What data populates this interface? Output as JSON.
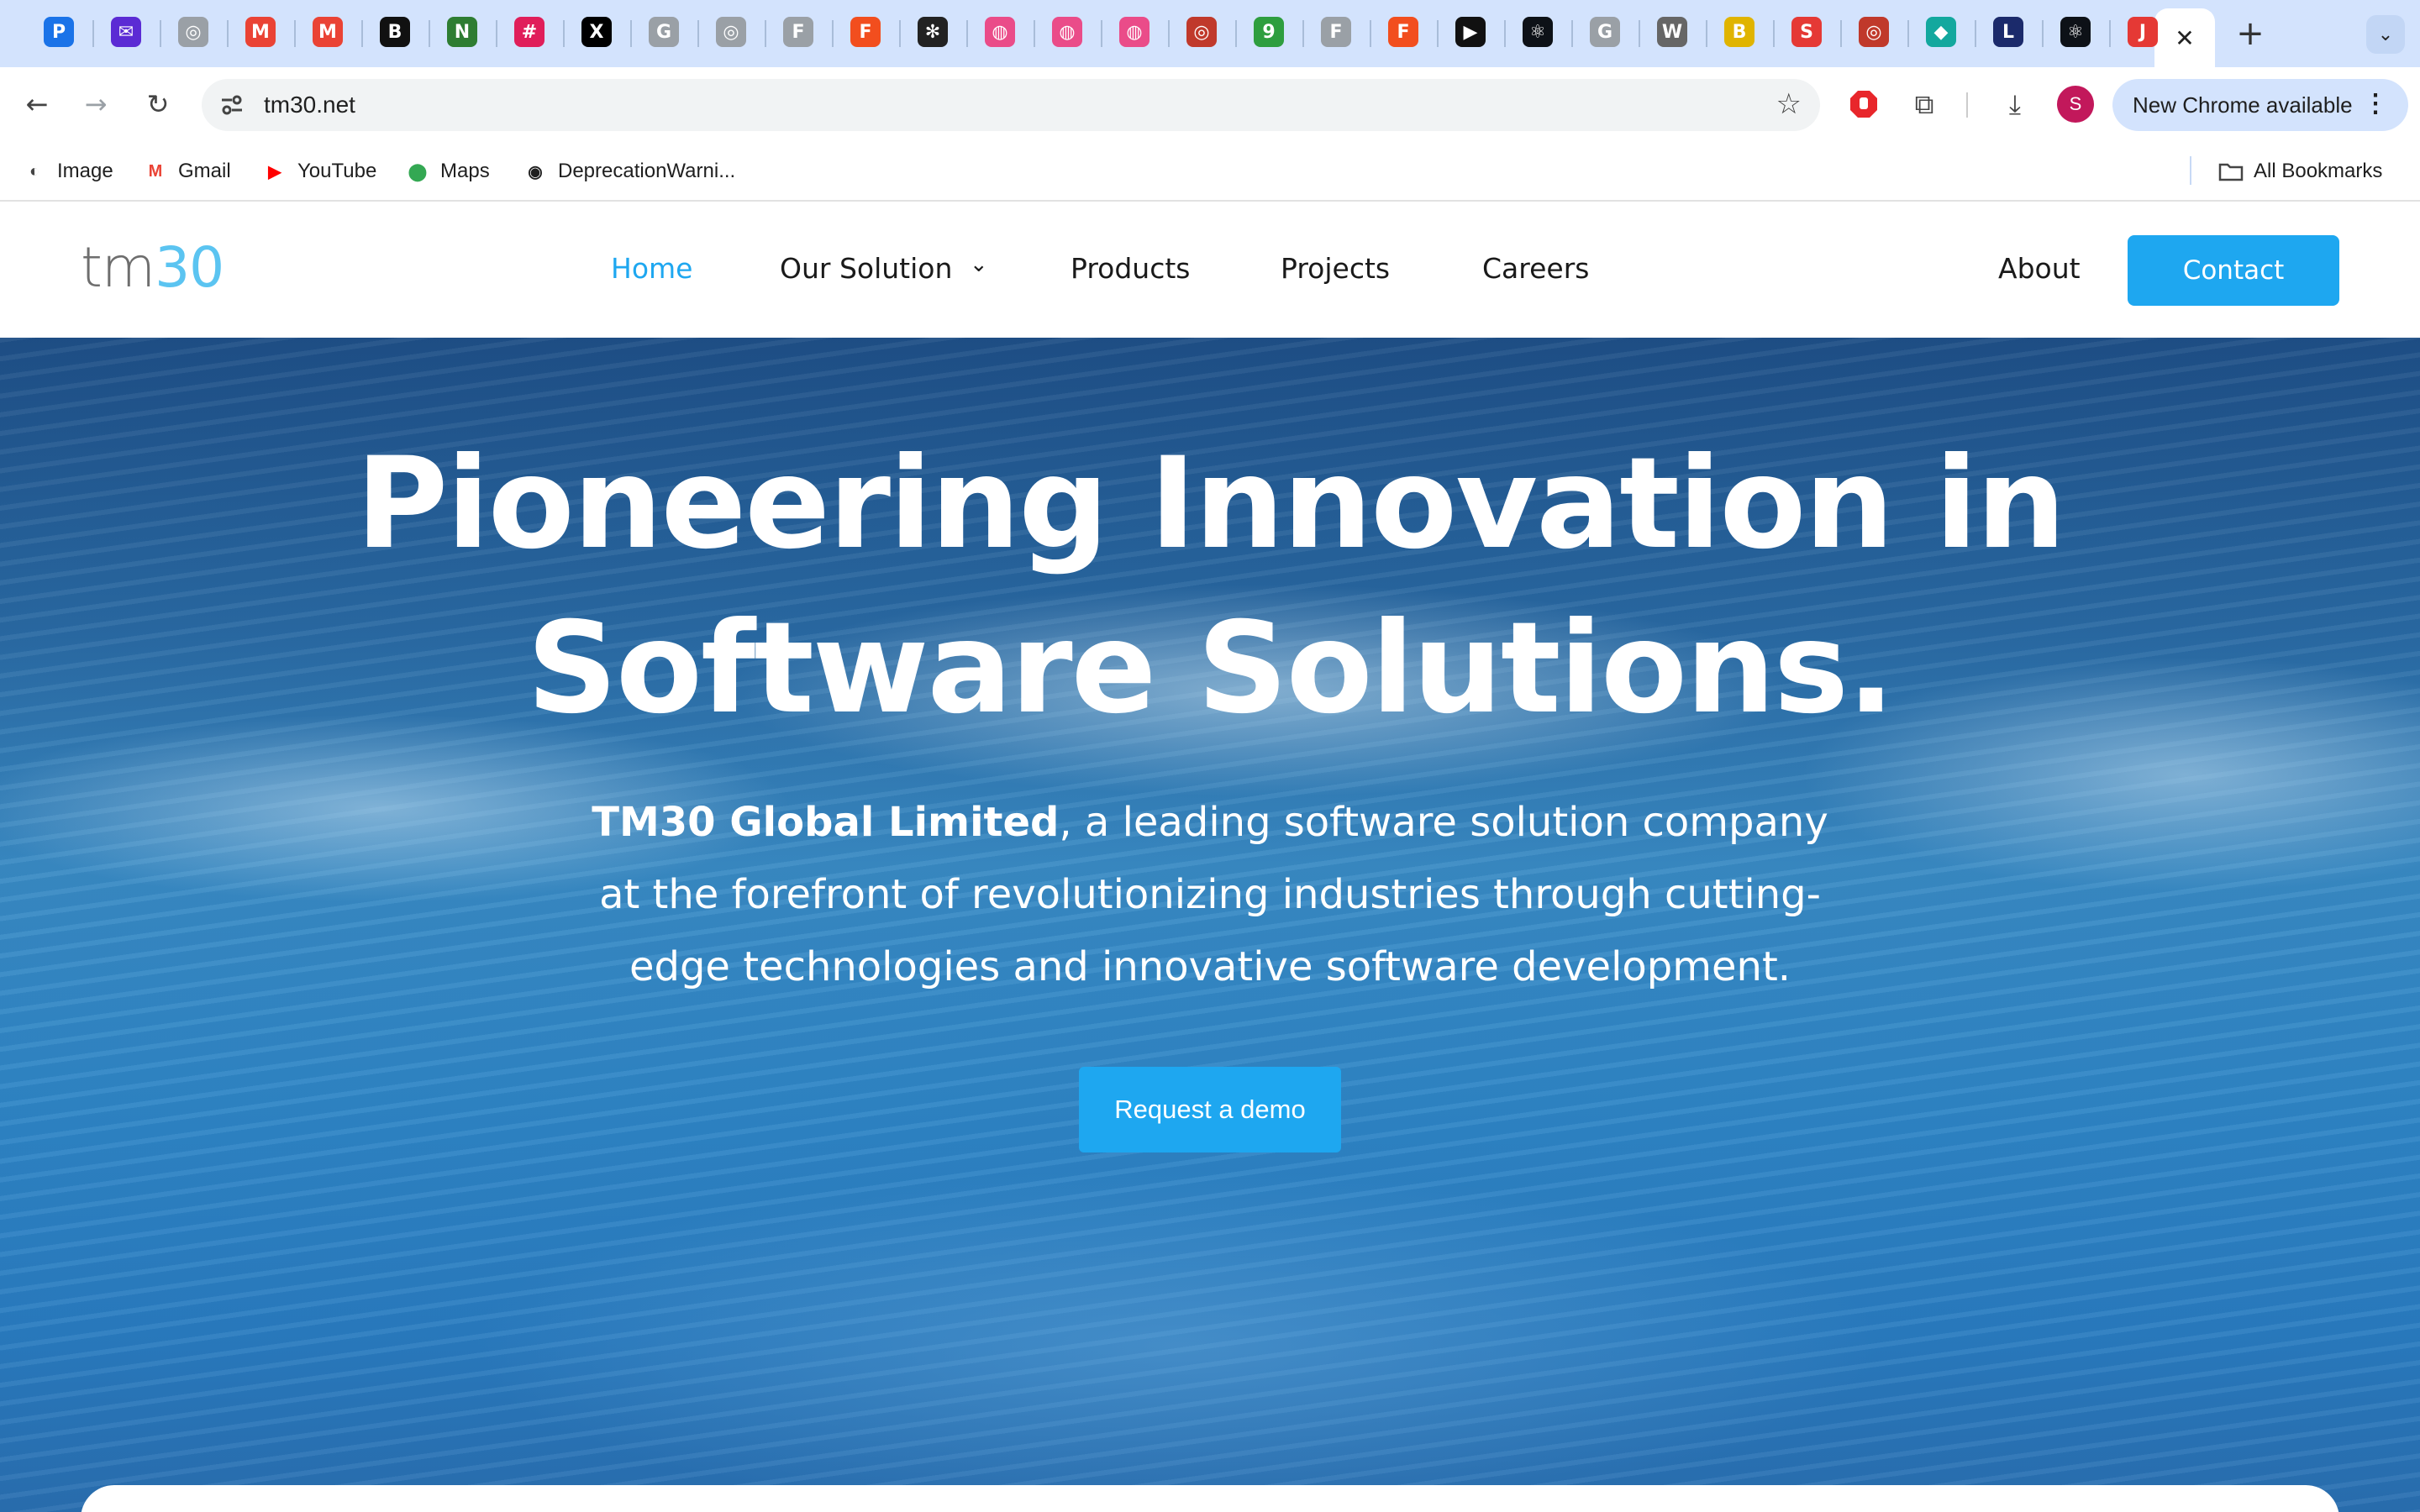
{
  "browser": {
    "tabs": [
      {
        "icon": "pipedrive-icon",
        "glyph": "P",
        "color": "#1a73e8"
      },
      {
        "icon": "mail-icon",
        "glyph": "✉",
        "color": "#5b2bd4"
      },
      {
        "icon": "chrome-page-icon",
        "glyph": "◎",
        "color": "#9aa0a6"
      },
      {
        "icon": "gmail-icon",
        "glyph": "M",
        "color": "#ea4335"
      },
      {
        "icon": "gmail-icon",
        "glyph": "M",
        "color": "#ea4335"
      },
      {
        "icon": "b-app-icon",
        "glyph": "B",
        "color": "#111111"
      },
      {
        "icon": "n-app-icon",
        "glyph": "N",
        "color": "#2e7d32"
      },
      {
        "icon": "slack-icon",
        "glyph": "#",
        "color": "#e01e5a"
      },
      {
        "icon": "x-icon",
        "glyph": "X",
        "color": "#000000"
      },
      {
        "icon": "google-icon",
        "glyph": "G",
        "color": "#9aa0a6"
      },
      {
        "icon": "web-icon",
        "glyph": "◎",
        "color": "#9aa0a6"
      },
      {
        "icon": "figma-page-icon",
        "glyph": "F",
        "color": "#9aa0a6"
      },
      {
        "icon": "figma-icon",
        "glyph": "F",
        "color": "#f24e1e"
      },
      {
        "icon": "openai-icon",
        "glyph": "✻",
        "color": "#222222"
      },
      {
        "icon": "dribbble-icon",
        "glyph": "◍",
        "color": "#ea4c89"
      },
      {
        "icon": "dribbble-icon",
        "glyph": "◍",
        "color": "#ea4c89"
      },
      {
        "icon": "dribbble-icon",
        "glyph": "◍",
        "color": "#ea4c89"
      },
      {
        "icon": "web-icon",
        "glyph": "◎",
        "color": "#c0392b"
      },
      {
        "icon": "naija-icon",
        "glyph": "9",
        "color": "#2e9e3f"
      },
      {
        "icon": "figma-page-icon",
        "glyph": "F",
        "color": "#9aa0a6"
      },
      {
        "icon": "figma-icon",
        "glyph": "F",
        "color": "#f24e1e"
      },
      {
        "icon": "play-icon",
        "glyph": "▶",
        "color": "#111111"
      },
      {
        "icon": "react-icon",
        "glyph": "⚛",
        "color": "#0d1117"
      },
      {
        "icon": "google-icon",
        "glyph": "G",
        "color": "#9aa0a6"
      },
      {
        "icon": "wikipedia-icon",
        "glyph": "W",
        "color": "#666666"
      },
      {
        "icon": "bank-icon",
        "glyph": "B",
        "color": "#e0b400"
      },
      {
        "icon": "s-app-icon",
        "glyph": "S",
        "color": "#e53935"
      },
      {
        "icon": "web-icon",
        "glyph": "◎",
        "color": "#c0392b"
      },
      {
        "icon": "diamond-icon",
        "glyph": "◆",
        "color": "#13a89e"
      },
      {
        "icon": "live-icon",
        "glyph": "L",
        "color": "#1b2a6b"
      },
      {
        "icon": "react-icon",
        "glyph": "⚛",
        "color": "#0d1117"
      },
      {
        "icon": "jpg-png-icon",
        "glyph": "J",
        "color": "#e53935"
      }
    ],
    "active_tab_close": "✕",
    "new_tab": "+",
    "tab_search": "⌄",
    "url": "tm30.net",
    "update_label": "New Chrome available",
    "update_menu": "⋮",
    "profile_initial": "S",
    "bookmarks": [
      {
        "label": "Image",
        "icon": "globe-icon",
        "glyph": "◐",
        "color": "#444444"
      },
      {
        "label": "Gmail",
        "icon": "gmail-icon",
        "glyph": "M",
        "color": "#ea4335"
      },
      {
        "label": "YouTube",
        "icon": "youtube-icon",
        "glyph": "▶",
        "color": "#ff0000"
      },
      {
        "label": "Maps",
        "icon": "maps-icon",
        "glyph": "⬤",
        "color": "#34a853"
      },
      {
        "label": "DeprecationWarni...",
        "icon": "github-icon",
        "glyph": "◉",
        "color": "#1f1f1f"
      }
    ],
    "all_bookmarks": "All Bookmarks"
  },
  "site": {
    "logo_tm": "tm",
    "logo_num": "30",
    "nav": [
      {
        "label": "Home",
        "active": true
      },
      {
        "label": "Our Solution",
        "caret": "⌄"
      },
      {
        "label": "Products"
      },
      {
        "label": "Projects"
      },
      {
        "label": "Careers"
      }
    ],
    "about": "About",
    "contact": "Contact",
    "hero": {
      "title_line1": "Pioneering Innovation in",
      "title_line2": "Software Solutions.",
      "sub_strong": "TM30 Global Limited",
      "sub_rest": ", a leading software solution company at the forefront of revolutionizing industries through cutting-edge technologies and innovative software development.",
      "cta": "Request a demo"
    }
  },
  "colors": {
    "accent": "#1ea7f0",
    "tabstrip": "#d3e3fd",
    "logo_gray": "#6e6e6e",
    "logo_blue": "#5bc4f1"
  }
}
